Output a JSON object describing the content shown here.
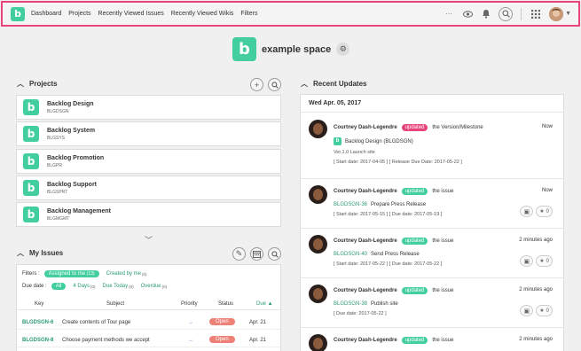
{
  "nav": {
    "links": [
      "Dashboard",
      "Projects",
      "Recently Viewed Issues",
      "Recently Viewed Wikis",
      "Filters"
    ],
    "more_glyph": "···"
  },
  "space": {
    "logo_letter": "b",
    "name": "example space"
  },
  "projects": {
    "heading": "Projects",
    "items": [
      {
        "name": "Backlog Design",
        "key": "BLGDSGN"
      },
      {
        "name": "Backlog System",
        "key": "BLGSYS"
      },
      {
        "name": "Backlog Promotion",
        "key": "BLGPR"
      },
      {
        "name": "Backlog Support",
        "key": "BLGSPRT"
      },
      {
        "name": "Backlog Management",
        "key": "BLGMGMT"
      }
    ]
  },
  "my_issues": {
    "heading": "My Issues",
    "filters_label": "Filters :",
    "filter_assigned": "Assigned to me",
    "filter_assigned_count": "(13)",
    "filter_created": "Created by me",
    "filter_created_count": "(0)",
    "due_label": "Due date :",
    "due_all": "All",
    "due_4days": "4 Days",
    "due_4days_count": "(0)",
    "due_today": "Due Today",
    "due_today_count": "(0)",
    "due_overdue": "Overdue",
    "due_overdue_count": "(0)",
    "columns": {
      "key": "Key",
      "subject": "Subject",
      "priority": "Priority",
      "status": "Status",
      "due": "Due ▲"
    },
    "rows": [
      {
        "key": "BLGDSGN-6",
        "subject": "Create contents of Tour page",
        "priority": "→",
        "status": "Open",
        "due": "Apr. 21"
      },
      {
        "key": "BLGDSGN-8",
        "subject": "Choose payment methods we accept",
        "priority": "→",
        "status": "Open",
        "due": "Apr. 21"
      }
    ]
  },
  "recent_updates": {
    "heading": "Recent Updates",
    "date": "Wed Apr. 05, 2017",
    "items": [
      {
        "user": "Courtney Dash-Legendre",
        "badge": "updated",
        "badge_color": "#e8457e",
        "target": "the Version/Milestone",
        "time": "Now",
        "line2_project": "Backlog Design (BLGDSGN)",
        "line3": "Ver.1.0 Launch site",
        "line4": "[ Start date: 2017-04-05 ] [ Release Due Date: 2017-05-22 ]"
      },
      {
        "user": "Courtney Dash-Legendre",
        "badge": "updated",
        "badge_color": "#42ce9f",
        "target": "the issue",
        "time": "Now",
        "issue_key": "BLGDSGN-36",
        "issue_title": "Prepare Press Release",
        "dates": "[ Start date: 2017-05-15 ] [ Due date: 2017-05-19 ]",
        "stars": "0"
      },
      {
        "user": "Courtney Dash-Legendre",
        "badge": "updated",
        "badge_color": "#42ce9f",
        "target": "the issue",
        "time": "2 minutes ago",
        "issue_key": "BLGDSGN-40",
        "issue_title": "Send Press Release",
        "dates": "[ Start date: 2017-05-22 ] [ Due date: 2017-05-22 ]",
        "stars": "0"
      },
      {
        "user": "Courtney Dash-Legendre",
        "badge": "updated",
        "badge_color": "#42ce9f",
        "target": "the issue",
        "time": "2 minutes ago",
        "issue_key": "BLGDSGN-38",
        "issue_title": "Publish site",
        "dates": "[ Due date: 2017-05-22 ]",
        "stars": "0"
      },
      {
        "user": "Courtney Dash-Legendre",
        "badge": "updated",
        "badge_color": "#42ce9f",
        "target": "the issue",
        "time": "2 minutes ago"
      }
    ]
  }
}
